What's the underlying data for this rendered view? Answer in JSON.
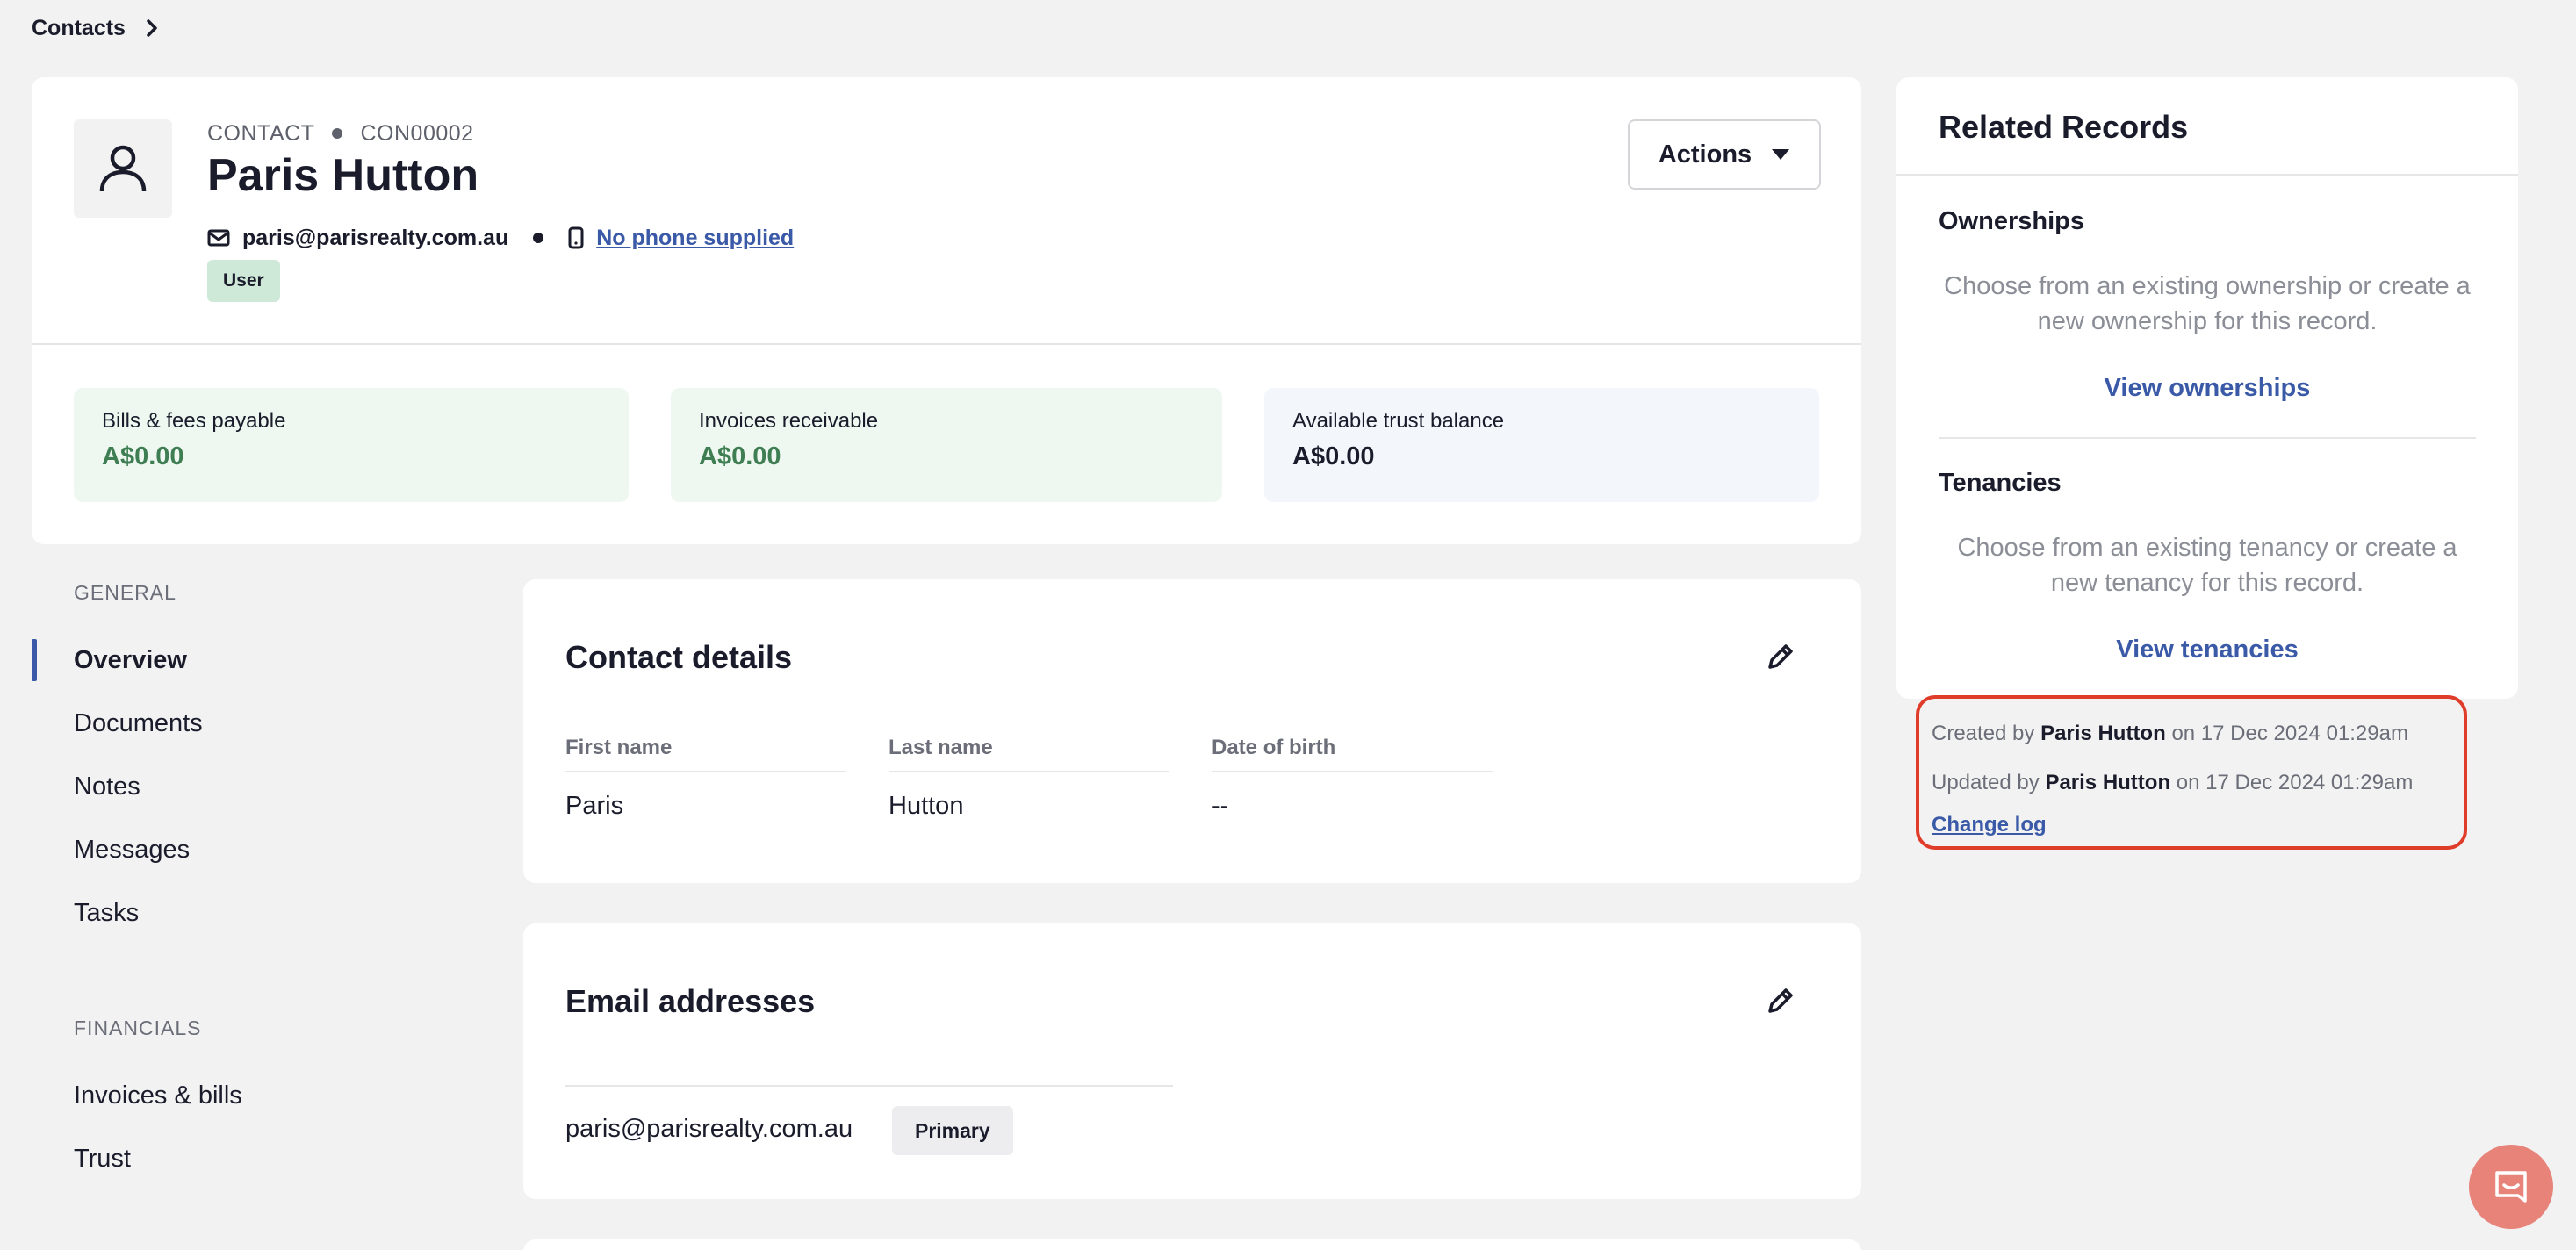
{
  "breadcrumb": {
    "root": "Contacts"
  },
  "header": {
    "type_label": "CONTACT",
    "code": "CON00002",
    "name": "Paris Hutton",
    "email": "paris@parisrealty.com.au",
    "phone": "No phone supplied",
    "role_badge": "User",
    "actions_label": "Actions"
  },
  "stats": [
    {
      "label": "Bills & fees payable",
      "value": "A$0.00"
    },
    {
      "label": "Invoices receivable",
      "value": "A$0.00"
    },
    {
      "label": "Available trust balance",
      "value": "A$0.00"
    }
  ],
  "nav": {
    "general_label": "GENERAL",
    "general_items": [
      "Overview",
      "Documents",
      "Notes",
      "Messages",
      "Tasks"
    ],
    "financials_label": "FINANCIALS",
    "financial_items": [
      "Invoices & bills",
      "Trust"
    ]
  },
  "contact_details": {
    "title": "Contact details",
    "first_name_label": "First name",
    "first_name": "Paris",
    "last_name_label": "Last name",
    "last_name": "Hutton",
    "dob_label": "Date of birth",
    "dob": "--"
  },
  "email_addresses": {
    "title": "Email addresses",
    "email": "paris@parisrealty.com.au",
    "badge": "Primary"
  },
  "related": {
    "title": "Related Records",
    "ownerships_title": "Ownerships",
    "ownerships_text": "Choose from an existing ownership or create a new ownership for this record.",
    "ownerships_link": "View ownerships",
    "tenancies_title": "Tenancies",
    "tenancies_text": "Choose from an existing tenancy or create a new tenancy for this record.",
    "tenancies_link": "View tenancies"
  },
  "audit": {
    "created_prefix": "Created by",
    "created_by": "Paris Hutton",
    "created_on": "on 17 Dec 2024 01:29am",
    "updated_prefix": "Updated by",
    "updated_by": "Paris Hutton",
    "updated_on": "on 17 Dec 2024 01:29am",
    "change_log": "Change log"
  },
  "colors": {
    "accent": "#3a5aa8",
    "positive": "#3f7e53",
    "highlight_border": "#e03c2a",
    "chat": "#e8837a"
  },
  "icons": [
    "chevron-right-icon",
    "user-icon",
    "envelope-icon",
    "mobile-phone-icon",
    "caret-down-icon",
    "pencil-icon",
    "chat-icon"
  ]
}
